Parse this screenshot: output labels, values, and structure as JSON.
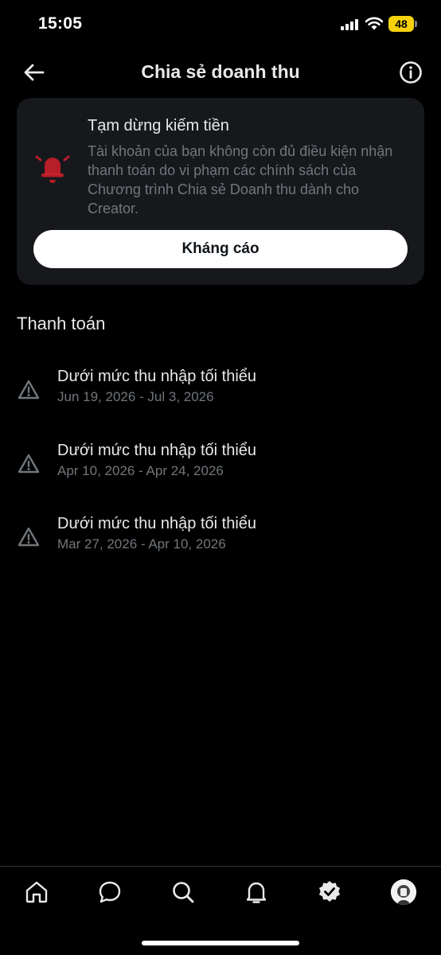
{
  "status_bar": {
    "time": "15:05",
    "battery": "48",
    "icons": [
      "signal-icon",
      "wifi-icon",
      "battery-icon"
    ]
  },
  "header": {
    "title": "Chia sẻ doanh thu",
    "back_icon": "arrow-left-icon",
    "info_icon": "info-icon"
  },
  "alert": {
    "icon": "bell-icon",
    "icon_color": "#f4212e",
    "title": "Tạm dừng kiếm tiền",
    "body": "Tài khoản của bạn không còn đủ điều kiện nhận thanh toán do vi phạm các chính sách của Chương trình Chia sẻ Doanh thu dành cho Creator.",
    "button_label": "Kháng cáo"
  },
  "payments": {
    "title": "Thanh toán",
    "items": [
      {
        "title": "Dưới mức thu nhập tối thiểu",
        "period": "Jun 19, 2026 - Jul 3, 2026"
      },
      {
        "title": "Dưới mức thu nhập tối thiểu",
        "period": "Apr 10, 2026 - Apr 24, 2026"
      },
      {
        "title": "Dưới mức thu nhập tối thiểu",
        "period": "Mar 27, 2026 - Apr 10, 2026"
      }
    ]
  },
  "bottom_nav": {
    "items": [
      "home-icon",
      "chat-bubble-icon",
      "search-icon",
      "notification-bell-icon",
      "verified-badge-icon",
      "avatar"
    ]
  },
  "colors": {
    "background": "#000000",
    "card": "#16181c",
    "text_primary": "#e7e9ea",
    "text_secondary": "#71767b",
    "battery": "#f5d20b"
  }
}
